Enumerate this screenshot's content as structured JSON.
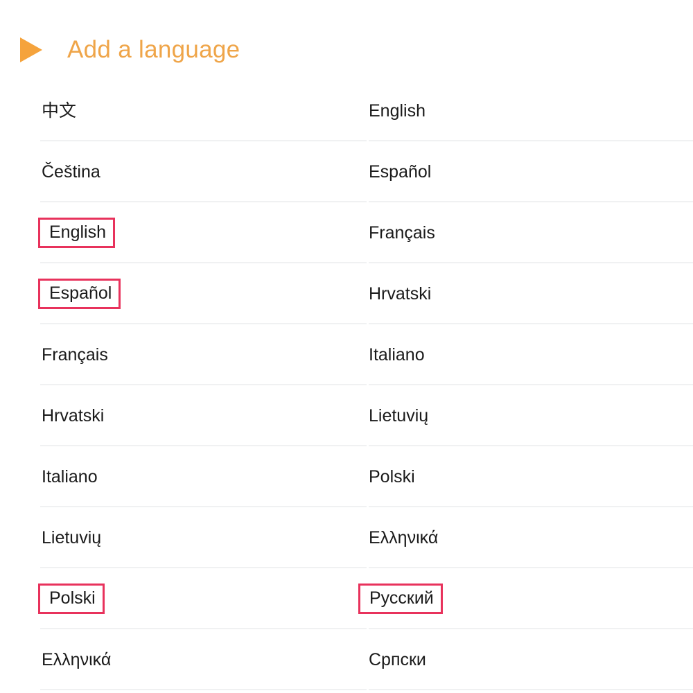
{
  "header": {
    "title": "Add a language",
    "icon": "play-triangle-icon",
    "accent_color": "#efa549",
    "triangle_color": "#f5a33c"
  },
  "theme": {
    "text_color": "#1a1a1a",
    "divider_color": "#f0f1f2",
    "highlight_color": "#e8325c",
    "background": "#ffffff"
  },
  "language_list": {
    "left_column": [
      {
        "label": "中文",
        "highlighted": false
      },
      {
        "label": "Čeština",
        "highlighted": false
      },
      {
        "label": "English",
        "highlighted": true
      },
      {
        "label": "Español",
        "highlighted": true
      },
      {
        "label": "Français",
        "highlighted": false
      },
      {
        "label": "Hrvatski",
        "highlighted": false
      },
      {
        "label": "Italiano",
        "highlighted": false
      },
      {
        "label": "Lietuvių",
        "highlighted": false
      },
      {
        "label": "Polski",
        "highlighted": true
      },
      {
        "label": "Ελληνικά",
        "highlighted": false
      }
    ],
    "right_column": [
      {
        "label": "English",
        "highlighted": false
      },
      {
        "label": "Español",
        "highlighted": false
      },
      {
        "label": "Français",
        "highlighted": false
      },
      {
        "label": "Hrvatski",
        "highlighted": false
      },
      {
        "label": "Italiano",
        "highlighted": false
      },
      {
        "label": "Lietuvių",
        "highlighted": false
      },
      {
        "label": "Polski",
        "highlighted": false
      },
      {
        "label": "Ελληνικά",
        "highlighted": false
      },
      {
        "label": "Русский",
        "highlighted": true
      },
      {
        "label": "Српски",
        "highlighted": false
      }
    ]
  }
}
